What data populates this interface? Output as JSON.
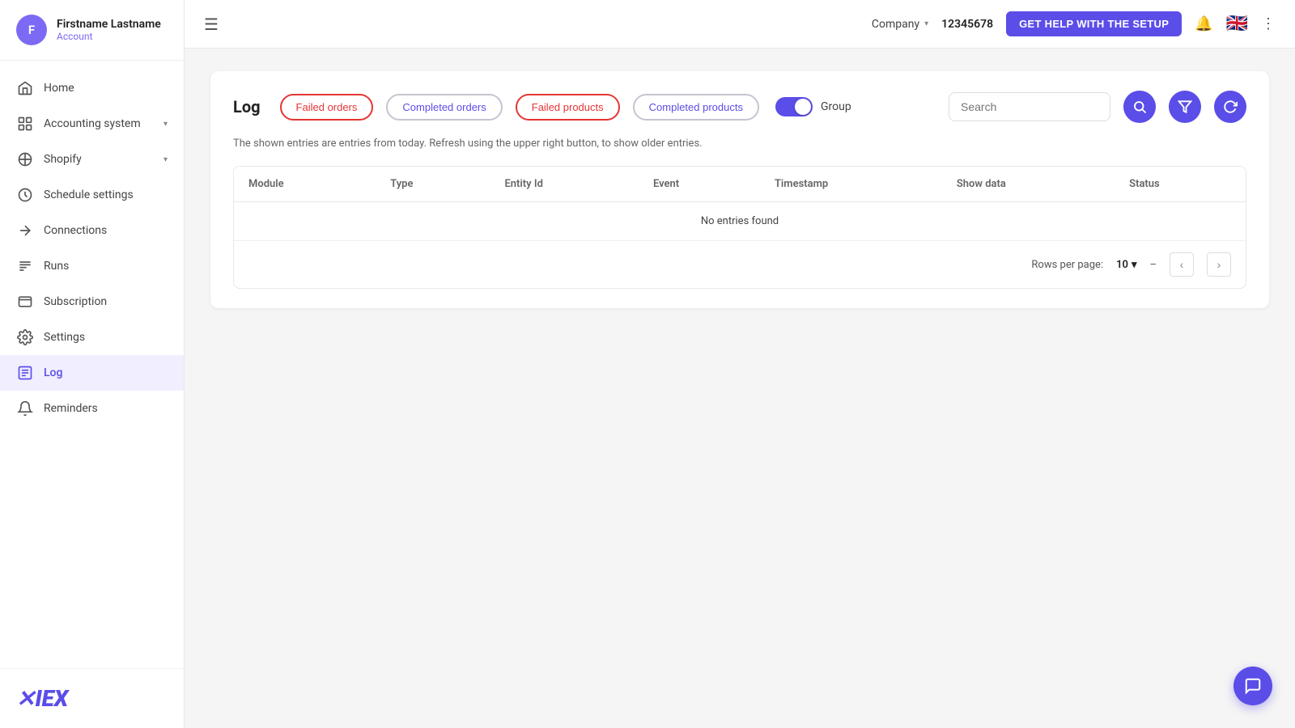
{
  "app": {
    "title": "XIEX"
  },
  "user": {
    "initials": "F",
    "name": "Firstname Lastname",
    "account_link": "Account",
    "avatar_bg": "#7c6af5"
  },
  "topbar": {
    "company_label": "Company",
    "company_id": "12345678",
    "help_btn": "GET HELP WITH THE SETUP"
  },
  "sidebar": {
    "items": [
      {
        "id": "home",
        "label": "Home",
        "icon": "home"
      },
      {
        "id": "accounting-system",
        "label": "Accounting system",
        "icon": "accounting",
        "has_chevron": true
      },
      {
        "id": "shopify",
        "label": "Shopify",
        "icon": "shopify",
        "has_chevron": true
      },
      {
        "id": "schedule-settings",
        "label": "Schedule settings",
        "icon": "schedule"
      },
      {
        "id": "connections",
        "label": "Connections",
        "icon": "connections"
      },
      {
        "id": "runs",
        "label": "Runs",
        "icon": "runs"
      },
      {
        "id": "subscription",
        "label": "Subscription",
        "icon": "subscription"
      },
      {
        "id": "settings",
        "label": "Settings",
        "icon": "settings"
      },
      {
        "id": "log",
        "label": "Log",
        "icon": "log",
        "active": true
      },
      {
        "id": "reminders",
        "label": "Reminders",
        "icon": "reminders"
      }
    ]
  },
  "log": {
    "title": "Log",
    "filters": {
      "failed_orders": "Failed orders",
      "completed_orders": "Completed orders",
      "failed_products": "Failed products",
      "completed_products": "Completed products"
    },
    "group_label": "Group",
    "group_active": true,
    "search_placeholder": "Search",
    "info_message": "The shown entries are entries from today. Refresh using the upper right button, to show older entries.",
    "table": {
      "columns": [
        "Module",
        "Type",
        "Entity Id",
        "Event",
        "Timestamp",
        "Show data",
        "Status"
      ],
      "no_entries_text": "No entries found"
    },
    "pagination": {
      "rows_per_page_label": "Rows per page:",
      "rows_value": "10",
      "page_range": "–"
    }
  }
}
